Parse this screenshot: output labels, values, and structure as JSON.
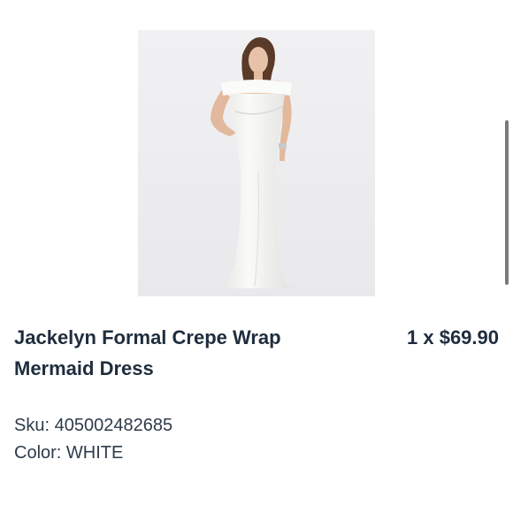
{
  "product": {
    "name": "Jackelyn Formal Crepe Wrap Mermaid Dress",
    "quantity": "1",
    "quantity_separator": " x ",
    "price": "$69.90",
    "sku_label": "Sku:",
    "sku_value": "405002482685",
    "color_label": "Color:",
    "color_value": "WHITE"
  },
  "colors": {
    "text": "#1f2d3d",
    "image_background": "#efeff1",
    "dress": "#f7f7f5"
  }
}
